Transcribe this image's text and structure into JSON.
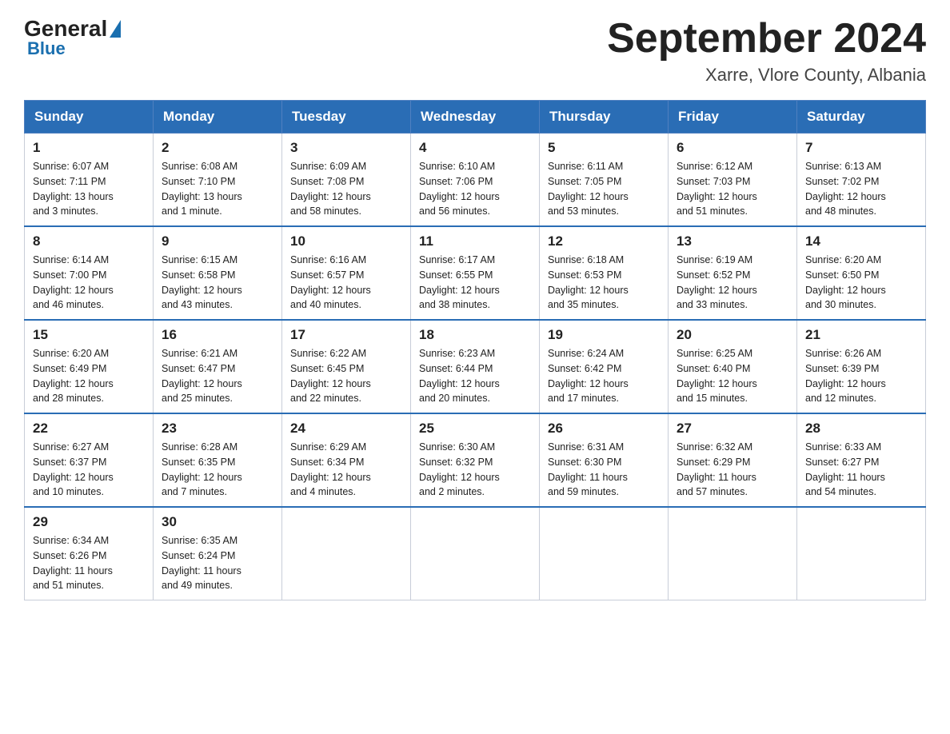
{
  "header": {
    "logo_general": "General",
    "logo_blue": "Blue",
    "title": "September 2024",
    "subtitle": "Xarre, Vlore County, Albania"
  },
  "days_of_week": [
    "Sunday",
    "Monday",
    "Tuesday",
    "Wednesday",
    "Thursday",
    "Friday",
    "Saturday"
  ],
  "weeks": [
    [
      {
        "day": "1",
        "sunrise": "6:07 AM",
        "sunset": "7:11 PM",
        "daylight": "13 hours and 3 minutes."
      },
      {
        "day": "2",
        "sunrise": "6:08 AM",
        "sunset": "7:10 PM",
        "daylight": "13 hours and 1 minute."
      },
      {
        "day": "3",
        "sunrise": "6:09 AM",
        "sunset": "7:08 PM",
        "daylight": "12 hours and 58 minutes."
      },
      {
        "day": "4",
        "sunrise": "6:10 AM",
        "sunset": "7:06 PM",
        "daylight": "12 hours and 56 minutes."
      },
      {
        "day": "5",
        "sunrise": "6:11 AM",
        "sunset": "7:05 PM",
        "daylight": "12 hours and 53 minutes."
      },
      {
        "day": "6",
        "sunrise": "6:12 AM",
        "sunset": "7:03 PM",
        "daylight": "12 hours and 51 minutes."
      },
      {
        "day": "7",
        "sunrise": "6:13 AM",
        "sunset": "7:02 PM",
        "daylight": "12 hours and 48 minutes."
      }
    ],
    [
      {
        "day": "8",
        "sunrise": "6:14 AM",
        "sunset": "7:00 PM",
        "daylight": "12 hours and 46 minutes."
      },
      {
        "day": "9",
        "sunrise": "6:15 AM",
        "sunset": "6:58 PM",
        "daylight": "12 hours and 43 minutes."
      },
      {
        "day": "10",
        "sunrise": "6:16 AM",
        "sunset": "6:57 PM",
        "daylight": "12 hours and 40 minutes."
      },
      {
        "day": "11",
        "sunrise": "6:17 AM",
        "sunset": "6:55 PM",
        "daylight": "12 hours and 38 minutes."
      },
      {
        "day": "12",
        "sunrise": "6:18 AM",
        "sunset": "6:53 PM",
        "daylight": "12 hours and 35 minutes."
      },
      {
        "day": "13",
        "sunrise": "6:19 AM",
        "sunset": "6:52 PM",
        "daylight": "12 hours and 33 minutes."
      },
      {
        "day": "14",
        "sunrise": "6:20 AM",
        "sunset": "6:50 PM",
        "daylight": "12 hours and 30 minutes."
      }
    ],
    [
      {
        "day": "15",
        "sunrise": "6:20 AM",
        "sunset": "6:49 PM",
        "daylight": "12 hours and 28 minutes."
      },
      {
        "day": "16",
        "sunrise": "6:21 AM",
        "sunset": "6:47 PM",
        "daylight": "12 hours and 25 minutes."
      },
      {
        "day": "17",
        "sunrise": "6:22 AM",
        "sunset": "6:45 PM",
        "daylight": "12 hours and 22 minutes."
      },
      {
        "day": "18",
        "sunrise": "6:23 AM",
        "sunset": "6:44 PM",
        "daylight": "12 hours and 20 minutes."
      },
      {
        "day": "19",
        "sunrise": "6:24 AM",
        "sunset": "6:42 PM",
        "daylight": "12 hours and 17 minutes."
      },
      {
        "day": "20",
        "sunrise": "6:25 AM",
        "sunset": "6:40 PM",
        "daylight": "12 hours and 15 minutes."
      },
      {
        "day": "21",
        "sunrise": "6:26 AM",
        "sunset": "6:39 PM",
        "daylight": "12 hours and 12 minutes."
      }
    ],
    [
      {
        "day": "22",
        "sunrise": "6:27 AM",
        "sunset": "6:37 PM",
        "daylight": "12 hours and 10 minutes."
      },
      {
        "day": "23",
        "sunrise": "6:28 AM",
        "sunset": "6:35 PM",
        "daylight": "12 hours and 7 minutes."
      },
      {
        "day": "24",
        "sunrise": "6:29 AM",
        "sunset": "6:34 PM",
        "daylight": "12 hours and 4 minutes."
      },
      {
        "day": "25",
        "sunrise": "6:30 AM",
        "sunset": "6:32 PM",
        "daylight": "12 hours and 2 minutes."
      },
      {
        "day": "26",
        "sunrise": "6:31 AM",
        "sunset": "6:30 PM",
        "daylight": "11 hours and 59 minutes."
      },
      {
        "day": "27",
        "sunrise": "6:32 AM",
        "sunset": "6:29 PM",
        "daylight": "11 hours and 57 minutes."
      },
      {
        "day": "28",
        "sunrise": "6:33 AM",
        "sunset": "6:27 PM",
        "daylight": "11 hours and 54 minutes."
      }
    ],
    [
      {
        "day": "29",
        "sunrise": "6:34 AM",
        "sunset": "6:26 PM",
        "daylight": "11 hours and 51 minutes."
      },
      {
        "day": "30",
        "sunrise": "6:35 AM",
        "sunset": "6:24 PM",
        "daylight": "11 hours and 49 minutes."
      },
      null,
      null,
      null,
      null,
      null
    ]
  ],
  "labels": {
    "sunrise": "Sunrise:",
    "sunset": "Sunset:",
    "daylight": "Daylight:"
  }
}
